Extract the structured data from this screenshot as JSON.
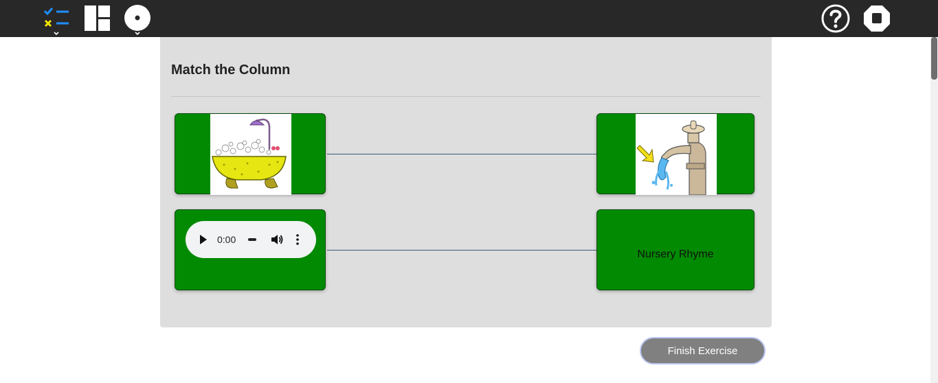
{
  "toolbar": {
    "icons": [
      "exercise-list-icon",
      "layout-grid-icon",
      "record-icon",
      "help-icon",
      "stop-icon"
    ],
    "accent_colors": {
      "check": "#1e90ff",
      "cross": "#f5e400"
    }
  },
  "exercise": {
    "title": "Match the Column",
    "left_items": [
      {
        "kind": "image",
        "icon": "bathtub-image"
      },
      {
        "kind": "audio",
        "time": "0:00"
      }
    ],
    "right_items": [
      {
        "kind": "image",
        "icon": "water-tap-image"
      },
      {
        "kind": "text",
        "label": "Nursery Rhyme"
      }
    ],
    "card_color": "#038a03"
  },
  "footer": {
    "finish_label": "Finish Exercise"
  }
}
